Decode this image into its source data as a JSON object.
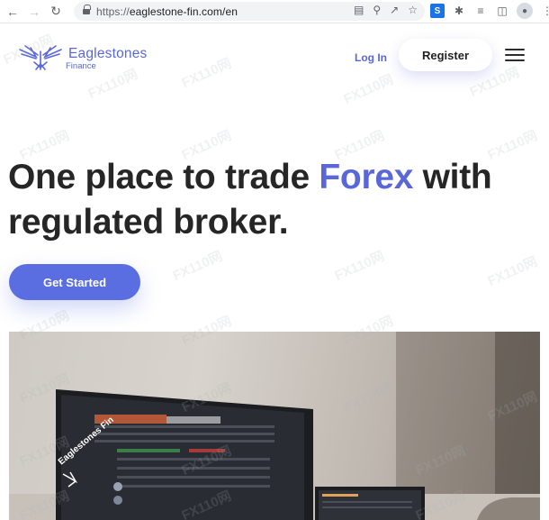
{
  "browser": {
    "url_protocol": "https://",
    "url_host": "eaglestone-fin.com/en",
    "back_icon": "arrow-left-icon",
    "forward_icon": "arrow-right-icon",
    "reload_icon": "reload-icon"
  },
  "header": {
    "brand_name": "Eaglestones",
    "brand_sub": "Finance",
    "login_label": "Log In",
    "register_label": "Register",
    "menu_icon": "hamburger-menu-icon"
  },
  "hero": {
    "title_part1": "One place to trade ",
    "title_accent": "Forex",
    "title_part2": " with regulated broker.",
    "cta_label": "Get Started"
  },
  "image": {
    "badge_text": "Eaglestones Fin"
  },
  "watermark": {
    "text": "FX110网"
  },
  "colors": {
    "accent": "#5a67d8",
    "cta": "#5b6ee1",
    "text": "#262626"
  }
}
